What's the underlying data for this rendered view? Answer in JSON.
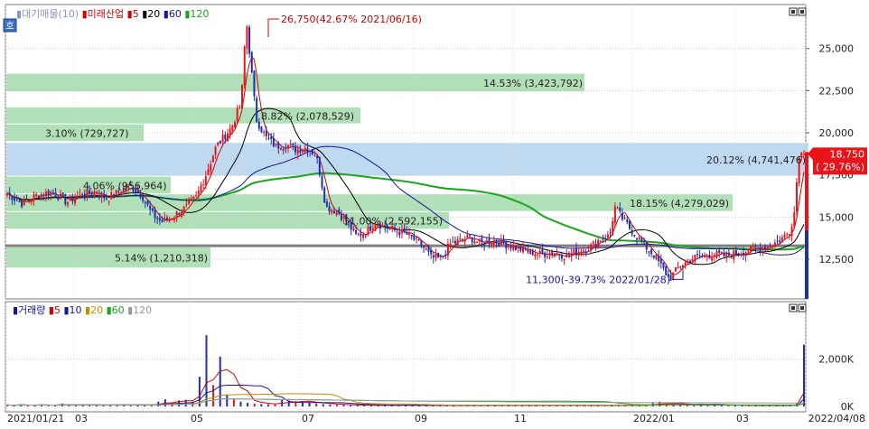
{
  "price_panel": {
    "icon_label": "호",
    "header": [
      {
        "text": "▮대기매물(10)",
        "color": "#8a93c7"
      },
      {
        "text": "▮미래산업",
        "color": "#d40000"
      },
      {
        "text": "▮5",
        "color": "#d40000"
      },
      {
        "text": "▮20",
        "color": "#000000"
      },
      {
        "text": "▮60",
        "color": "#1414a0"
      },
      {
        "text": "▮120",
        "color": "#1aa61a"
      }
    ]
  },
  "volume_panel": {
    "header": [
      {
        "text": "▮거래량",
        "color": "#1414a0"
      },
      {
        "text": "▮5",
        "color": "#d40000"
      },
      {
        "text": "▮10",
        "color": "#1414a0"
      },
      {
        "text": "▮20",
        "color": "#c98a00"
      },
      {
        "text": "▮60",
        "color": "#1aa61a"
      },
      {
        "text": "▮120",
        "color": "#999999"
      }
    ]
  },
  "chart_data": [
    {
      "type": "candlestick",
      "title": "",
      "xlabel": "",
      "ylabel": "",
      "ylim": [
        10250,
        27500
      ],
      "y_ticks": [
        "25,000",
        "22,500",
        "20,000",
        "17,500",
        "15,000",
        "12,500"
      ],
      "y_tick_values": [
        25000,
        22500,
        20000,
        17500,
        15000,
        12500
      ],
      "x_ticks": [
        "2021/01/21",
        "03",
        "05",
        "07",
        "09",
        "11",
        "2022/01",
        "03",
        "2022/04/08"
      ],
      "grid": true,
      "colors": {
        "up": "#e8141a",
        "down": "#1e2fb4",
        "ma5": "#d40000",
        "ma20": "#000000",
        "ma60": "#1414a0",
        "ma120": "#1aa61a",
        "zone": "#a9dcb0",
        "zone_current": "#b8d6ec"
      },
      "volume_profile": [
        {
          "label": "14.53% (3,423,792)",
          "low": 22400,
          "high": 23500
        },
        {
          "label": "8.82% (2,078,529)",
          "low": 20500,
          "high": 21500
        },
        {
          "label": "3.10% (729,727)",
          "low": 19450,
          "high": 20500
        },
        {
          "label": "20.12% (4,741,476)",
          "low": 17400,
          "high": 19400
        },
        {
          "label": "4.06% (956,964)",
          "low": 16350,
          "high": 17400
        },
        {
          "label": "18.15% (4,279,029)",
          "low": 15300,
          "high": 16350
        },
        {
          "label": "11.00% (2,592,155)",
          "low": 14250,
          "high": 15300
        },
        {
          "label": "5.14% (1,210,318)",
          "low": 11950,
          "high": 13200
        }
      ],
      "support_line": 13300,
      "annotations": [
        {
          "text": "26,750(42.67% 2021/06/16)",
          "value": 26750,
          "color": "#d40000"
        },
        {
          "text": "11,300(-39.73% 2022/01/28)",
          "value": 11300,
          "color": "#1414a0"
        }
      ],
      "current": {
        "price": "18,750",
        "change": "( 29.76%)",
        "value": 18750
      },
      "price_path": [
        [
          0,
          16400
        ],
        [
          0.03,
          15800
        ],
        [
          0.06,
          16300
        ],
        [
          0.09,
          16500
        ],
        [
          0.12,
          15900
        ],
        [
          0.15,
          16400
        ],
        [
          0.18,
          16500
        ],
        [
          0.2,
          16100
        ],
        [
          0.23,
          16600
        ],
        [
          0.25,
          16800
        ],
        [
          0.27,
          16300
        ],
        [
          0.29,
          15200
        ],
        [
          0.31,
          14700
        ],
        [
          0.33,
          15000
        ],
        [
          0.36,
          15600
        ],
        [
          0.38,
          16200
        ],
        [
          0.4,
          17600
        ],
        [
          0.42,
          19200
        ],
        [
          0.45,
          20300
        ],
        [
          0.47,
          21800
        ],
        [
          0.48,
          26750
        ],
        [
          0.5,
          20800
        ],
        [
          0.52,
          19700
        ],
        [
          0.54,
          19200
        ],
        [
          0.56,
          19300
        ],
        [
          0.58,
          19000
        ],
        [
          0.6,
          19100
        ],
        [
          0.62,
          18700
        ],
        [
          0.63,
          17300
        ],
        [
          0.64,
          15600
        ],
        [
          0.66,
          15400
        ],
        [
          0.68,
          14800
        ],
        [
          0.7,
          13900
        ],
        [
          0.72,
          14100
        ],
        [
          0.74,
          14700
        ],
        [
          0.76,
          14400
        ],
        [
          0.78,
          14200
        ],
        [
          0.8,
          14000
        ],
        [
          0.82,
          13600
        ],
        [
          0.84,
          13100
        ],
        [
          0.85,
          12600
        ],
        [
          0.87,
          12500
        ],
        [
          0.89,
          13400
        ],
        [
          0.91,
          13600
        ],
        [
          0.93,
          13800
        ],
        [
          0.95,
          13400
        ],
        [
          0.97,
          13600
        ],
        [
          0.99,
          13500
        ],
        [
          1.02,
          13200
        ],
        [
          1.04,
          13000
        ],
        [
          1.07,
          12800
        ],
        [
          1.1,
          12900
        ],
        [
          1.12,
          12700
        ],
        [
          1.15,
          13000
        ],
        [
          1.17,
          13200
        ],
        [
          1.19,
          13700
        ],
        [
          1.21,
          13900
        ],
        [
          1.22,
          15600
        ],
        [
          1.24,
          14700
        ],
        [
          1.26,
          14000
        ],
        [
          1.28,
          13300
        ],
        [
          1.3,
          12700
        ],
        [
          1.32,
          11800
        ],
        [
          1.33,
          11300
        ],
        [
          1.35,
          12100
        ],
        [
          1.38,
          12600
        ],
        [
          1.4,
          12700
        ],
        [
          1.42,
          12800
        ],
        [
          1.44,
          12700
        ],
        [
          1.47,
          12900
        ],
        [
          1.5,
          13100
        ],
        [
          1.53,
          13300
        ],
        [
          1.55,
          13600
        ],
        [
          1.57,
          14100
        ],
        [
          1.58,
          15100
        ],
        [
          1.59,
          18750
        ]
      ]
    },
    {
      "type": "bar",
      "title": "",
      "xlabel": "",
      "ylabel": "",
      "ylim": [
        0,
        3500000
      ],
      "y_ticks": [
        "2,000K",
        "0K"
      ],
      "y_tick_values": [
        2000000,
        0
      ],
      "grid": true,
      "values": [
        60000,
        50000,
        80000,
        40000,
        60000,
        70000,
        50000,
        40000,
        120000,
        60000,
        50000,
        80000,
        60000,
        50000,
        40000,
        70000,
        60000,
        90000,
        50000,
        60000,
        40000,
        80000,
        200000,
        300000,
        150000,
        250000,
        280000,
        200000,
        1250000,
        3000000,
        900000,
        2100000,
        500000,
        300000,
        200000,
        150000,
        120000,
        100000,
        90000,
        80000,
        300000,
        250000,
        220000,
        180000,
        150000,
        120000,
        100000,
        80000,
        70000,
        60000,
        50000,
        60000,
        50000,
        40000,
        50000,
        60000,
        50000,
        40000,
        60000,
        50000,
        40000,
        50000,
        45000,
        40000,
        50000,
        35000,
        40000,
        50000,
        45000,
        40000,
        50000,
        60000,
        50000,
        40000,
        50000,
        45000,
        40000,
        60000,
        50000,
        40000,
        55000,
        40000,
        50000,
        45000,
        40000,
        38000,
        42000,
        50000,
        40000,
        45000,
        50000,
        40000,
        60000,
        50000,
        150000,
        200000,
        120000,
        80000,
        60000,
        70000,
        50000,
        60000,
        50000,
        80000,
        60000,
        50000,
        40000,
        45000,
        40000,
        42000,
        38000,
        45000,
        40000,
        50000,
        60000,
        150000,
        2600000
      ]
    }
  ]
}
